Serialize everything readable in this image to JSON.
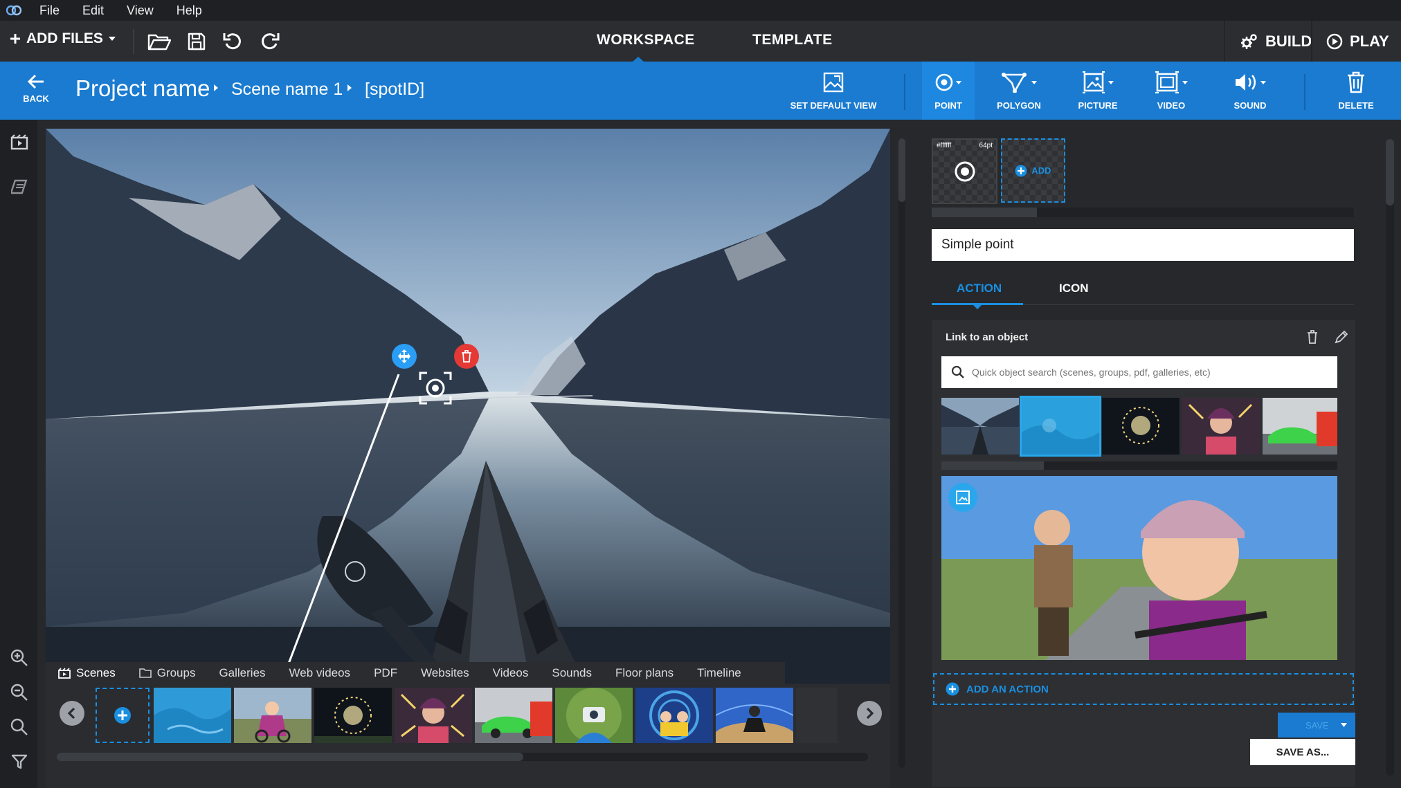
{
  "menubar": {
    "items": [
      "File",
      "Edit",
      "View",
      "Help"
    ]
  },
  "toolbar": {
    "add_files_label": "ADD FILES",
    "modes": [
      "WORKSPACE",
      "TEMPLATE"
    ],
    "active_mode": "WORKSPACE",
    "build_label": "BUILD",
    "play_label": "PLAY"
  },
  "breadcrumb": {
    "back_label": "BACK",
    "project": "Project name",
    "scene": "Scene name 1",
    "spot": "[spotID]"
  },
  "tools": {
    "set_default_view": "SET DEFAULT VIEW",
    "point": "POINT",
    "polygon": "POLYGON",
    "picture": "PICTURE",
    "video": "VIDEO",
    "sound": "SOUND",
    "delete": "DELETE",
    "active_tool": "POINT"
  },
  "strip": {
    "tabs": [
      "Scenes",
      "Groups",
      "Galleries",
      "Web videos",
      "PDF",
      "Websites",
      "Videos",
      "Sounds",
      "Floor plans",
      "Timeline"
    ],
    "active_tab": "Scenes",
    "scene_thumbnails": [
      "lake-blue",
      "rider-bike",
      "sparks-night",
      "girl-lights",
      "green-car",
      "drone-rider",
      "spiral-riders",
      "desert-biker"
    ]
  },
  "panel": {
    "icon_tile": {
      "color_label": "#ffffff",
      "size_label": "64pt"
    },
    "add_label": "ADD",
    "name_value": "Simple point",
    "tabs": [
      "ACTION",
      "ICON"
    ],
    "active_tab": "ACTION",
    "card_title": "Link to an object",
    "search_placeholder": "Quick object search (scenes, groups, pdf, galleries, etc)",
    "object_thumbnails": [
      "kayak-lake",
      "blue-selected",
      "sparks-night",
      "girl-lights",
      "car-smoke"
    ],
    "selected_object": "blue-selected",
    "add_action_label": "ADD AN ACTION",
    "save_label": "SAVE",
    "save_as_label": "SAVE AS..."
  },
  "colors": {
    "accent": "#1a8fe0",
    "blue_bar": "#1a7bd0",
    "delete_red": "#e53935",
    "move_blue": "#2a9df4"
  }
}
